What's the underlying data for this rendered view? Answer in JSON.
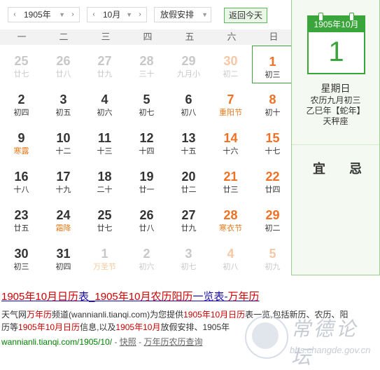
{
  "toolbar": {
    "year": "1905年",
    "month": "10月",
    "holiday": "放假安排",
    "today_button": "返回今天",
    "prev_arrow": "‹",
    "next_arrow": "›",
    "caret": "▼"
  },
  "weekdays": [
    "一",
    "二",
    "三",
    "四",
    "五",
    "六",
    "日"
  ],
  "rows": [
    [
      {
        "n": "25",
        "l": "廿七",
        "other": true
      },
      {
        "n": "26",
        "l": "廿八",
        "other": true
      },
      {
        "n": "27",
        "l": "廿九",
        "other": true
      },
      {
        "n": "28",
        "l": "三十",
        "other": true
      },
      {
        "n": "29",
        "l": "九月小",
        "other": true
      },
      {
        "n": "30",
        "l": "初二",
        "other": true,
        "wknd": true
      },
      {
        "n": "1",
        "l": "初三",
        "wknd": true,
        "sel": true
      }
    ],
    [
      {
        "n": "2",
        "l": "初四"
      },
      {
        "n": "3",
        "l": "初五"
      },
      {
        "n": "4",
        "l": "初六"
      },
      {
        "n": "5",
        "l": "初七"
      },
      {
        "n": "6",
        "l": "初八"
      },
      {
        "n": "7",
        "l": "重阳节",
        "wknd": true,
        "fest": true
      },
      {
        "n": "8",
        "l": "初十",
        "wknd": true
      }
    ],
    [
      {
        "n": "9",
        "l": "寒露",
        "fest": true
      },
      {
        "n": "10",
        "l": "十二"
      },
      {
        "n": "11",
        "l": "十三"
      },
      {
        "n": "12",
        "l": "十四"
      },
      {
        "n": "13",
        "l": "十五"
      },
      {
        "n": "14",
        "l": "十六",
        "wknd": true
      },
      {
        "n": "15",
        "l": "十七",
        "wknd": true
      }
    ],
    [
      {
        "n": "16",
        "l": "十八"
      },
      {
        "n": "17",
        "l": "十九"
      },
      {
        "n": "18",
        "l": "二十"
      },
      {
        "n": "19",
        "l": "廿一"
      },
      {
        "n": "20",
        "l": "廿二"
      },
      {
        "n": "21",
        "l": "廿三",
        "wknd": true
      },
      {
        "n": "22",
        "l": "廿四",
        "wknd": true
      }
    ],
    [
      {
        "n": "23",
        "l": "廿五"
      },
      {
        "n": "24",
        "l": "霜降",
        "fest": true
      },
      {
        "n": "25",
        "l": "廿七"
      },
      {
        "n": "26",
        "l": "廿八"
      },
      {
        "n": "27",
        "l": "廿九"
      },
      {
        "n": "28",
        "l": "寒衣节",
        "wknd": true,
        "fest": true
      },
      {
        "n": "29",
        "l": "初二",
        "wknd": true
      }
    ],
    [
      {
        "n": "30",
        "l": "初三"
      },
      {
        "n": "31",
        "l": "初四"
      },
      {
        "n": "1",
        "l": "万圣节",
        "other": true,
        "fest": true
      },
      {
        "n": "2",
        "l": "初六",
        "other": true
      },
      {
        "n": "3",
        "l": "初七",
        "other": true
      },
      {
        "n": "4",
        "l": "初八",
        "other": true,
        "wknd": true
      },
      {
        "n": "5",
        "l": "初九",
        "other": true,
        "wknd": true
      }
    ]
  ],
  "detail": {
    "header": "1905年10月",
    "day": "1",
    "weekday": "星期日",
    "lunar": "农历九月初三",
    "ganzhi": "乙巳年【蛇年】",
    "zodiac": "天秤座",
    "yi": "宜",
    "ji": "忌"
  },
  "result": {
    "title_parts": [
      {
        "t": "1905年10月日历",
        "hl": true
      },
      {
        "t": "表_",
        "hl": false
      },
      {
        "t": "1905年10月",
        "hl": true
      },
      {
        "t": "农历阳历",
        "hl": true
      },
      {
        "t": "一览表-",
        "hl": false
      },
      {
        "t": "万年历",
        "hl": true
      }
    ],
    "desc_line1": [
      {
        "t": "天气网",
        "hl": false
      },
      {
        "t": "万年历",
        "hl": true
      },
      {
        "t": "频道(wannianli.tianqi.com)为您提供",
        "hl": false
      },
      {
        "t": "1905年10月日历",
        "hl": true
      },
      {
        "t": "表一览,包括新历、农历、阳",
        "hl": false
      }
    ],
    "desc_line2": [
      {
        "t": "历等",
        "hl": false
      },
      {
        "t": "1905年10月日历",
        "hl": true
      },
      {
        "t": "信息,以及",
        "hl": false
      },
      {
        "t": "1905年10月",
        "hl": true
      },
      {
        "t": "放假安排、1905年",
        "hl": false
      }
    ],
    "url": "wannianli.tianqi.com/1905/10/",
    "sep1": " - ",
    "snapshot": "快照",
    "sep2": " - ",
    "link": "万年历农历查询"
  },
  "watermark": {
    "title": "常德论坛",
    "url": "bbs.changde.gov.cn"
  },
  "colors": {
    "accent_green": "#3aa53a",
    "weekend_orange": "#f07024",
    "festival_orange": "#e07c1f",
    "link_blue": "#1a0dab",
    "highlight_red": "#cc0000"
  }
}
